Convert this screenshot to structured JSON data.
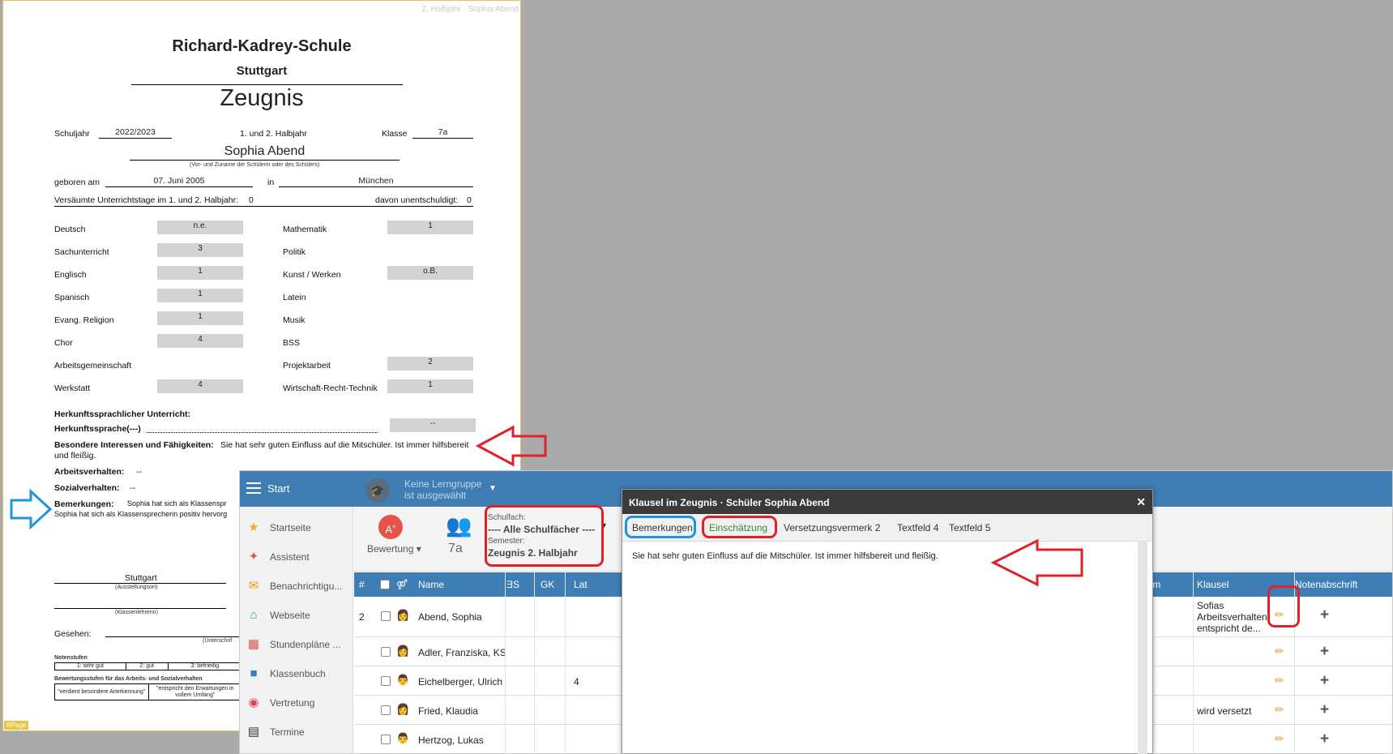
{
  "doc": {
    "header_small": "2. Halbjahr · Sophia Abend",
    "school_name": "Richard-Kadrey-Schule",
    "city": "Stuttgart",
    "title": "Zeugnis",
    "schuljahr_label": "Schuljahr",
    "schuljahr_value": "2022/2023",
    "halbjahr_text": "1. und 2. Halbjahr",
    "klasse_label": "Klasse",
    "klasse_value": "7a",
    "student_name": "Sophia Abend",
    "name_caption": "(Vor- und Zuname der Schülerin oder des Schülers)",
    "born_label": "geboren am",
    "born_value": "07. Juni 2005",
    "in_label": "in",
    "birthplace": "München",
    "missed_label": "Versäumte Unterrichtstage im 1. und 2. Halbjahr:",
    "missed_value": "0",
    "unexcused_label": "davon unentschuldigt:",
    "unexcused_value": "0",
    "subjects_left": [
      {
        "name": "Deutsch",
        "grade": "n.e."
      },
      {
        "name": "Sachunterricht",
        "grade": "3"
      },
      {
        "name": "Englisch",
        "grade": "1"
      },
      {
        "name": "Spanisch",
        "grade": "1"
      },
      {
        "name": "Evang. Religion",
        "grade": "1"
      },
      {
        "name": "Chor",
        "grade": "4"
      },
      {
        "name": "Arbeitsgemeinschaft",
        "grade": ""
      },
      {
        "name": "Werkstatt",
        "grade": "4"
      }
    ],
    "subjects_right": [
      {
        "name": "Mathematik",
        "grade": "1"
      },
      {
        "name": "Politik",
        "grade": ""
      },
      {
        "name": "Kunst / Werken",
        "grade": "o.B."
      },
      {
        "name": "Latein",
        "grade": ""
      },
      {
        "name": "Musik",
        "grade": ""
      },
      {
        "name": "BSS",
        "grade": ""
      },
      {
        "name": "Projektarbeit",
        "grade": "2"
      },
      {
        "name": "Wirtschaft-Recht-Technik",
        "grade": "1"
      }
    ],
    "herkunft_label": "Herkunftssprachlicher Unterricht:",
    "herkunft_sprache_label": "Herkunftssprache(---)",
    "herkunft_grade": "--",
    "interessen_label": "Besondere Interessen und Fähigkeiten:",
    "interessen_text": "Sie hat sehr guten Einfluss auf die Mitschüler. Ist immer hilfsbereit",
    "interessen_text2": "und fleißig.",
    "arbeit_label": "Arbeitsverhalten:",
    "arbeit_value": "--",
    "sozial_label": "Sozialverhalten:",
    "sozial_value": "--",
    "bemerkungen_label": "Bemerkungen:",
    "bemerkungen_text": "Sophia hat sich als Klassenspr",
    "bemerkungen_text2": "Sophia hat sich als Klassensprecherin positiv hervorg",
    "ort_value": "Stuttgart",
    "ort_caption": "(Ausstellungsort)",
    "lehrer_caption": "(Klassenlehrerin)",
    "gesehen_label": "Gesehen:",
    "unterschrift_caption": "(Unterschrif",
    "notenstufen_label": "Notenstufen",
    "notenstufen": [
      "1: sehr gut",
      "2: gut",
      "3: befriedig"
    ],
    "bewertung_label": "Bewertungsstufen für das Arbeits- und Sozialverhalten",
    "bewertung1": "\"verdient besondere Anerkennung\"",
    "bewertung2": "\"entspricht den Erwartungen in vollem Umfang\"",
    "footer_tag": "RPage"
  },
  "app": {
    "start_label": "Start",
    "group_line1": "Keine Lerngruppe",
    "group_line2": "ist ausgewählt",
    "nav": [
      {
        "label": "Startseite",
        "icon": "star-icon",
        "glyph": "★",
        "color": "#f0b020"
      },
      {
        "label": "Assistent",
        "icon": "wand-icon",
        "glyph": "✦",
        "color": "#e05a40"
      },
      {
        "label": "Benachrichtigu...",
        "icon": "mail-icon",
        "glyph": "✉",
        "color": "#f09a20"
      },
      {
        "label": "Webseite",
        "icon": "home-icon",
        "glyph": "⌂",
        "color": "#2aa37a"
      },
      {
        "label": "Stundenpläne ...",
        "icon": "calendar-icon",
        "glyph": "▦",
        "color": "#e05050"
      },
      {
        "label": "Klassenbuch",
        "icon": "book-icon",
        "glyph": "■",
        "color": "#3a7dc0"
      },
      {
        "label": "Vertretung",
        "icon": "substitution-icon",
        "glyph": "◉",
        "color": "#e04050"
      },
      {
        "label": "Termine",
        "icon": "clapper-icon",
        "glyph": "▤",
        "color": "#333333"
      }
    ],
    "bewertung_label": "Bewertung",
    "class_label": "7a",
    "filter_subject_label": "Schulfach:",
    "filter_subject_value": "---- Alle Schulfächer ----",
    "filter_semester_label": "Semester:",
    "filter_semester_value": "Zeugnis 2. Halbjahr",
    "grid_headers": {
      "num": "#",
      "gender": "⚤",
      "name": "Name",
      "c1": "ƎS",
      "c2": "GK",
      "c3": "Lat",
      "praktikum": "raktikum",
      "klausel": "Klausel",
      "notenabschrift": "Notenabschrift"
    },
    "rows": [
      {
        "num": "2",
        "name": "Abend, Sophia",
        "c3": "",
        "klausel": "Sofias Arbeitsverhalten entspricht de..."
      },
      {
        "num": "",
        "name": "Adler, Franziska, KS",
        "c3": "",
        "klausel": ""
      },
      {
        "num": "",
        "name": "Eichelberger, Ulrich",
        "c3": "4",
        "klausel": ""
      },
      {
        "num": "",
        "name": "Fried, Klaudia",
        "c3": "",
        "klausel": "wird versetzt"
      },
      {
        "num": "",
        "name": "Hertzog, Lukas",
        "c3": "",
        "klausel": ""
      }
    ]
  },
  "dialog": {
    "title": "Klausel im Zeugnis · Schüler Sophia Abend",
    "close": "✕",
    "tabs": [
      "Bemerkungen",
      "Einschätzung",
      "Versetzungsvermerk 2",
      "Textfeld 4",
      "Textfeld 5"
    ],
    "text": "Sie hat sehr guten Einfluss auf die Mitschüler. Ist immer hilfsbereit und fleißig."
  },
  "colors": {
    "accent": "#3e7eb5",
    "highlight_red": "#e0202a",
    "highlight_blue": "#1e96d6"
  }
}
